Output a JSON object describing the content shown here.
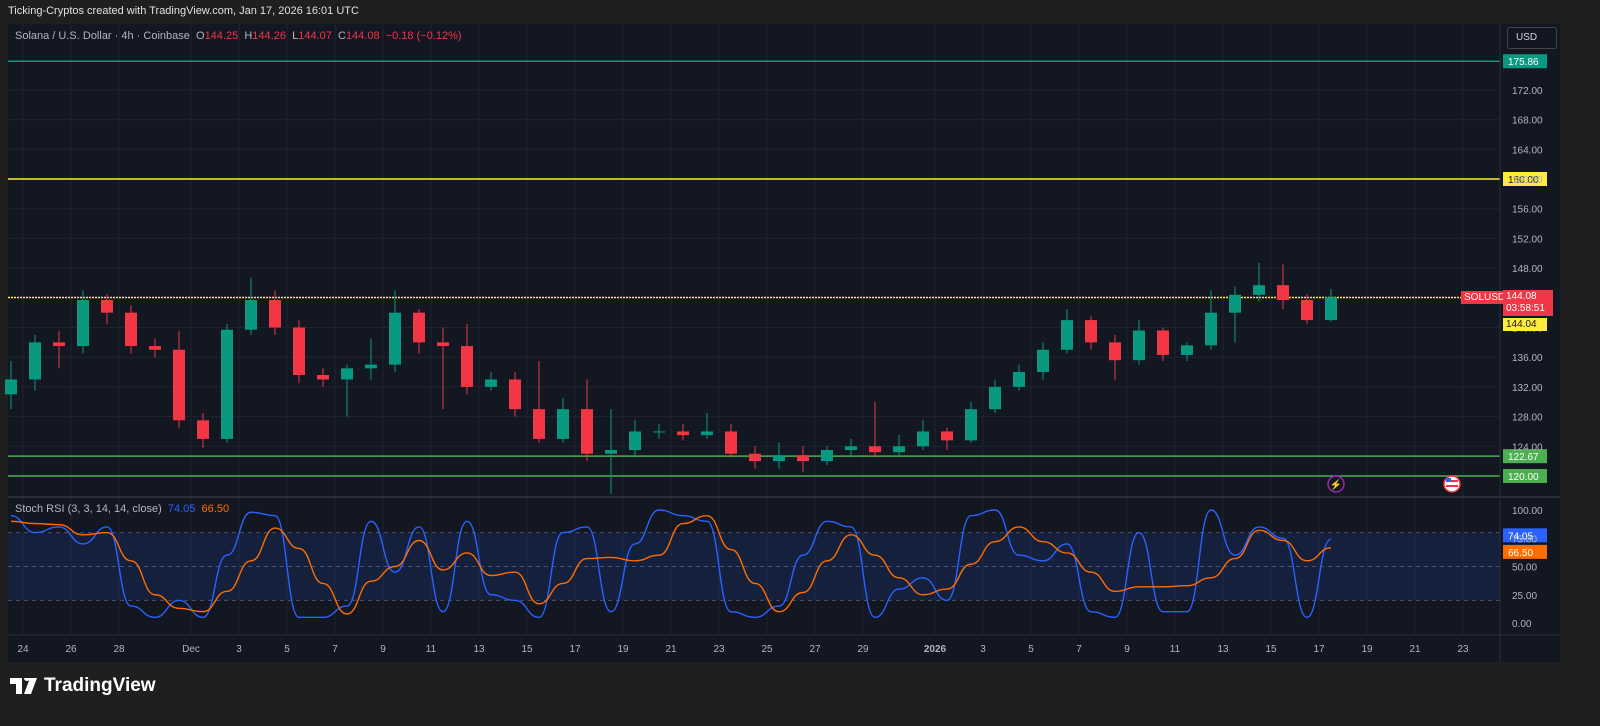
{
  "header": {
    "attribution": "Ticking-Cryptos created with TradingView.com, Jan 17, 2026 16:01 UTC"
  },
  "legend": {
    "symbol": "Solana / U.S. Dollar · 4h · Coinbase",
    "o_label": "O",
    "o": "144.25",
    "h_label": "H",
    "h": "144.26",
    "l_label": "L",
    "l": "144.07",
    "c_label": "C",
    "c": "144.08",
    "change": "−0.18 (−0.12%)"
  },
  "currency_button": "USD",
  "price_tag": {
    "symbol": "SOLUSD",
    "price": "144.08",
    "countdown": "03:58:51",
    "level": "144.04"
  },
  "logo": {
    "text": "TradingView"
  },
  "colors": {
    "up": "#089981",
    "down": "#f23645",
    "k_line": "#2962ff",
    "d_line": "#ff6d00",
    "teal_level": "#089981",
    "yellow_level": "#ffeb3b",
    "green_level": "#4caf50",
    "background": "#131722"
  },
  "icons": [
    "lightning-event-icon",
    "us-flag-event-icon",
    "tradingview-logo-icon"
  ],
  "chart_data": [
    {
      "type": "candlestick",
      "title": "Solana / U.S. Dollar · 4h · Coinbase",
      "ylim": [
        116,
        178
      ],
      "y_ticks": [
        124,
        128,
        132,
        136,
        140,
        144,
        148,
        152,
        156,
        160,
        164,
        168,
        172
      ],
      "x_ticks": [
        "24",
        "26",
        "28",
        "Dec",
        "3",
        "5",
        "7",
        "9",
        "11",
        "13",
        "15",
        "17",
        "19",
        "21",
        "23",
        "25",
        "27",
        "29",
        "2026",
        "3",
        "5",
        "7",
        "9",
        "11",
        "13",
        "15",
        "17",
        "19",
        "21",
        "23"
      ],
      "x_tick_days": [
        "2025-11-24",
        "2025-11-26",
        "2025-11-28",
        "2025-12-01",
        "2025-12-03",
        "2025-12-05",
        "2025-12-07",
        "2025-12-09",
        "2025-12-11",
        "2025-12-13",
        "2025-12-15",
        "2025-12-17",
        "2025-12-19",
        "2025-12-21",
        "2025-12-23",
        "2025-12-25",
        "2025-12-27",
        "2025-12-29",
        "2026-01-01",
        "2026-01-03",
        "2026-01-05",
        "2026-01-07",
        "2026-01-09",
        "2026-01-11",
        "2026-01-13",
        "2026-01-15",
        "2026-01-17",
        "2026-01-19",
        "2026-01-21",
        "2026-01-23"
      ],
      "grid": true,
      "horizontal_levels": [
        {
          "value": 175.86,
          "label": "175.86",
          "color": "#089981"
        },
        {
          "value": 160.0,
          "label": "160.00",
          "color": "#ffeb3b"
        },
        {
          "value": 144.04,
          "label": "144.04",
          "color": "#ffeb3b"
        },
        {
          "value": 122.67,
          "label": "122.67",
          "color": "#4caf50"
        },
        {
          "value": 120.0,
          "label": "120.00",
          "color": "#4caf50"
        }
      ],
      "candles": [
        {
          "d": "2025-11-23",
          "o": 131.0,
          "h": 135.5,
          "l": 129.0,
          "c": 133.0
        },
        {
          "d": "2025-11-24",
          "o": 133.0,
          "h": 139.0,
          "l": 131.5,
          "c": 138.0
        },
        {
          "d": "2025-11-25",
          "o": 138.0,
          "h": 139.5,
          "l": 134.5,
          "c": 137.5
        },
        {
          "d": "2025-11-26",
          "o": 137.5,
          "h": 145.0,
          "l": 136.5,
          "c": 143.7
        },
        {
          "d": "2025-11-27",
          "o": 143.7,
          "h": 144.5,
          "l": 140.5,
          "c": 142.0
        },
        {
          "d": "2025-11-28",
          "o": 142.0,
          "h": 143.0,
          "l": 136.5,
          "c": 137.5
        },
        {
          "d": "2025-11-29",
          "o": 137.5,
          "h": 138.5,
          "l": 136.0,
          "c": 137.0
        },
        {
          "d": "2025-11-30",
          "o": 137.0,
          "h": 139.5,
          "l": 126.5,
          "c": 127.5
        },
        {
          "d": "2025-12-01",
          "o": 127.5,
          "h": 128.5,
          "l": 123.8,
          "c": 125.0
        },
        {
          "d": "2025-12-02",
          "o": 125.0,
          "h": 140.5,
          "l": 124.5,
          "c": 139.7
        },
        {
          "d": "2025-12-03",
          "o": 139.7,
          "h": 146.7,
          "l": 139.0,
          "c": 143.7
        },
        {
          "d": "2025-12-04",
          "o": 143.7,
          "h": 145.0,
          "l": 139.0,
          "c": 140.0
        },
        {
          "d": "2025-12-05",
          "o": 140.0,
          "h": 141.0,
          "l": 132.5,
          "c": 133.6
        },
        {
          "d": "2025-12-06",
          "o": 133.6,
          "h": 134.5,
          "l": 132.0,
          "c": 133.0
        },
        {
          "d": "2025-12-07",
          "o": 133.0,
          "h": 135.0,
          "l": 128.0,
          "c": 134.5
        },
        {
          "d": "2025-12-08",
          "o": 134.5,
          "h": 138.5,
          "l": 133.0,
          "c": 135.0
        },
        {
          "d": "2025-12-09",
          "o": 135.0,
          "h": 145.0,
          "l": 134.0,
          "c": 142.0
        },
        {
          "d": "2025-12-10",
          "o": 142.0,
          "h": 142.5,
          "l": 136.5,
          "c": 138.0
        },
        {
          "d": "2025-12-11",
          "o": 138.0,
          "h": 140.0,
          "l": 129.0,
          "c": 137.5
        },
        {
          "d": "2025-12-12",
          "o": 137.5,
          "h": 140.5,
          "l": 131.0,
          "c": 132.0
        },
        {
          "d": "2025-12-13",
          "o": 132.0,
          "h": 134.0,
          "l": 131.5,
          "c": 133.0
        },
        {
          "d": "2025-12-14",
          "o": 133.0,
          "h": 134.0,
          "l": 128.0,
          "c": 129.0
        },
        {
          "d": "2025-12-15",
          "o": 129.0,
          "h": 135.5,
          "l": 124.5,
          "c": 125.0
        },
        {
          "d": "2025-12-16",
          "o": 125.0,
          "h": 130.5,
          "l": 124.5,
          "c": 129.0
        },
        {
          "d": "2025-12-17",
          "o": 129.0,
          "h": 133.0,
          "l": 122.0,
          "c": 123.0
        },
        {
          "d": "2025-12-18",
          "o": 123.0,
          "h": 129.0,
          "l": 117.6,
          "c": 123.5
        },
        {
          "d": "2025-12-19",
          "o": 123.5,
          "h": 127.5,
          "l": 122.5,
          "c": 126.0
        },
        {
          "d": "2025-12-20",
          "o": 126.0,
          "h": 127.0,
          "l": 125.0,
          "c": 126.0
        },
        {
          "d": "2025-12-21",
          "o": 126.0,
          "h": 127.0,
          "l": 124.8,
          "c": 125.5
        },
        {
          "d": "2025-12-22",
          "o": 125.5,
          "h": 128.5,
          "l": 125.0,
          "c": 126.0
        },
        {
          "d": "2025-12-23",
          "o": 126.0,
          "h": 127.0,
          "l": 122.5,
          "c": 123.0
        },
        {
          "d": "2025-12-24",
          "o": 123.0,
          "h": 124.0,
          "l": 121.0,
          "c": 122.0
        },
        {
          "d": "2025-12-25",
          "o": 122.0,
          "h": 124.5,
          "l": 121.0,
          "c": 122.8
        },
        {
          "d": "2025-12-26",
          "o": 122.8,
          "h": 124.0,
          "l": 120.5,
          "c": 122.0
        },
        {
          "d": "2025-12-27",
          "o": 122.0,
          "h": 124.0,
          "l": 121.5,
          "c": 123.5
        },
        {
          "d": "2025-12-28",
          "o": 123.5,
          "h": 125.0,
          "l": 122.8,
          "c": 124.0
        },
        {
          "d": "2025-12-29",
          "o": 124.0,
          "h": 130.0,
          "l": 122.5,
          "c": 123.2
        },
        {
          "d": "2025-12-30",
          "o": 123.2,
          "h": 125.5,
          "l": 122.8,
          "c": 124.0
        },
        {
          "d": "2025-12-31",
          "o": 124.0,
          "h": 127.5,
          "l": 123.5,
          "c": 126.0
        },
        {
          "d": "2026-01-01",
          "o": 126.0,
          "h": 126.5,
          "l": 123.5,
          "c": 124.8
        },
        {
          "d": "2026-01-02",
          "o": 124.8,
          "h": 130.0,
          "l": 124.5,
          "c": 129.0
        },
        {
          "d": "2026-01-03",
          "o": 129.0,
          "h": 133.0,
          "l": 128.5,
          "c": 132.0
        },
        {
          "d": "2026-01-04",
          "o": 132.0,
          "h": 135.0,
          "l": 131.5,
          "c": 134.0
        },
        {
          "d": "2026-01-05",
          "o": 134.0,
          "h": 138.0,
          "l": 133.0,
          "c": 137.0
        },
        {
          "d": "2026-01-06",
          "o": 137.0,
          "h": 142.5,
          "l": 136.5,
          "c": 141.0
        },
        {
          "d": "2026-01-07",
          "o": 141.0,
          "h": 141.5,
          "l": 137.0,
          "c": 138.0
        },
        {
          "d": "2026-01-08",
          "o": 138.0,
          "h": 139.0,
          "l": 133.0,
          "c": 135.6
        },
        {
          "d": "2026-01-09",
          "o": 135.6,
          "h": 141.0,
          "l": 135.0,
          "c": 139.6
        },
        {
          "d": "2026-01-10",
          "o": 139.6,
          "h": 140.0,
          "l": 135.5,
          "c": 136.3
        },
        {
          "d": "2026-01-11",
          "o": 136.3,
          "h": 138.0,
          "l": 135.5,
          "c": 137.6
        },
        {
          "d": "2026-01-12",
          "o": 137.6,
          "h": 145.0,
          "l": 137.0,
          "c": 142.0
        },
        {
          "d": "2026-01-13",
          "o": 142.0,
          "h": 145.5,
          "l": 138.0,
          "c": 144.4
        },
        {
          "d": "2026-01-14",
          "o": 144.4,
          "h": 148.7,
          "l": 143.5,
          "c": 145.7
        },
        {
          "d": "2026-01-15",
          "o": 145.7,
          "h": 148.5,
          "l": 142.5,
          "c": 143.7
        },
        {
          "d": "2026-01-16",
          "o": 143.7,
          "h": 144.5,
          "l": 140.5,
          "c": 141.0
        },
        {
          "d": "2026-01-17",
          "o": 141.0,
          "h": 145.2,
          "l": 140.8,
          "c": 144.08
        }
      ]
    },
    {
      "type": "line",
      "title": "Stoch RSI (3, 3, 14, 14, close)",
      "ylim": [
        0,
        100
      ],
      "y_ticks": [
        0,
        25,
        50,
        75,
        100
      ],
      "y_tick_labels": [
        "0.00",
        "25.00",
        "50.00",
        "75.00",
        "100.00"
      ],
      "bands": {
        "upper": 80,
        "middle": 50,
        "lower": 20
      },
      "last_values": {
        "k": "74.05",
        "d": "66.50"
      },
      "series": [
        {
          "key": "k",
          "color": "#2962ff",
          "values": [
            95,
            80,
            85,
            70,
            85,
            15,
            5,
            20,
            5,
            60,
            98,
            95,
            5,
            5,
            15,
            90,
            45,
            85,
            10,
            90,
            25,
            20,
            5,
            80,
            85,
            10,
            70,
            100,
            95,
            90,
            10,
            5,
            15,
            60,
            90,
            85,
            5,
            30,
            40,
            20,
            95,
            100,
            60,
            55,
            70,
            10,
            5,
            80,
            10,
            10,
            100,
            60,
            85,
            75,
            5,
            74.05
          ]
        },
        {
          "key": "d",
          "color": "#ff6d00",
          "values": [
            90,
            88,
            87,
            78,
            80,
            55,
            25,
            13,
            10,
            28,
            55,
            84,
            66,
            35,
            8,
            37,
            50,
            73,
            47,
            62,
            42,
            45,
            17,
            35,
            57,
            58,
            55,
            60,
            88,
            95,
            65,
            35,
            10,
            27,
            55,
            78,
            60,
            40,
            25,
            30,
            52,
            72,
            85,
            72,
            62,
            45,
            28,
            32,
            32,
            33,
            40,
            57,
            82,
            73,
            55,
            66.5
          ]
        }
      ]
    }
  ]
}
